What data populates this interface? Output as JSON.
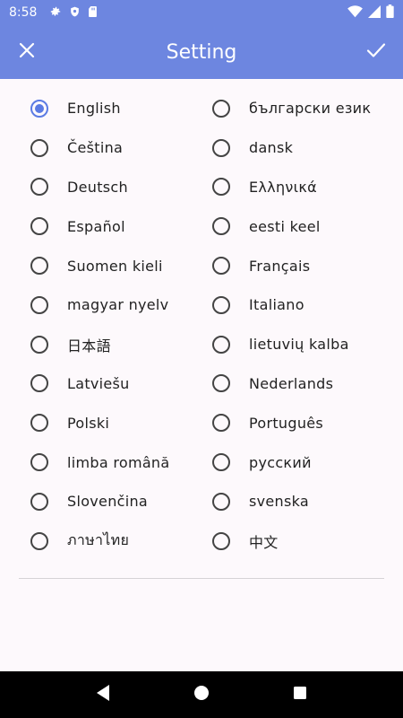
{
  "status_bar": {
    "time": "8:58",
    "icons_left": [
      "settings-icon",
      "shield-icon",
      "sd-card-icon"
    ],
    "icons_right": [
      "wifi-icon",
      "signal-icon",
      "battery-icon"
    ]
  },
  "app_bar": {
    "title": "Setting",
    "left_icon": "close-icon",
    "right_icon": "check-icon",
    "color": "#6d86e0"
  },
  "languages": {
    "selected": "English",
    "accent_color": "#5b7be3",
    "left": [
      "English",
      "Čeština",
      "Deutsch",
      "Español",
      "Suomen kieli",
      "magyar nyelv",
      "日本語",
      "Latviešu",
      "Polski",
      "limba română",
      "Slovenčina",
      "ภาษาไทย"
    ],
    "right": [
      "български език",
      "dansk",
      "Ελληνικά",
      "eesti keel",
      "Français",
      "Italiano",
      "lietuvių kalba",
      "Nederlands",
      "Português",
      "русский",
      "svenska",
      "中文"
    ]
  },
  "nav_bar": {
    "buttons": [
      "back-icon",
      "home-icon",
      "recents-icon"
    ]
  }
}
